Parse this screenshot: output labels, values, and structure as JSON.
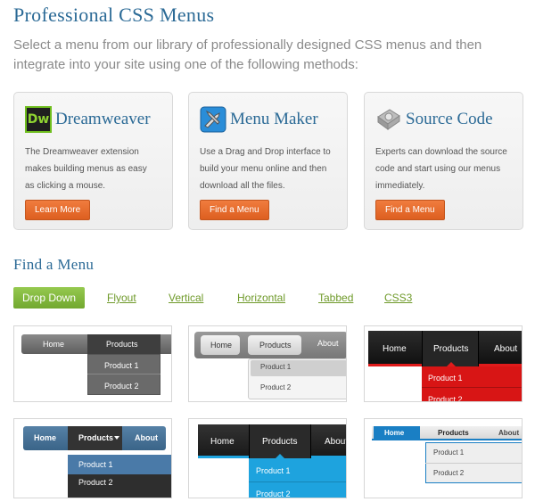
{
  "header": {
    "title": "Professional CSS Menus",
    "intro": "Select a menu from our library of professionally designed CSS menus and then integrate into your site using one of the following methods:"
  },
  "cards": [
    {
      "icon": "dreamweaver-icon",
      "icon_text": "Dw",
      "title": "Dreamweaver",
      "desc": "The Dreamweaver extension makes building menus as easy as clicking a mouse.",
      "button": "Learn More"
    },
    {
      "icon": "menu-maker-icon",
      "title": "Menu Maker",
      "desc": "Use a Drag and Drop interface to build your menu online and then download all the files.",
      "button": "Find a Menu"
    },
    {
      "icon": "source-code-icon",
      "title": "Source Code",
      "desc": "Experts can download the source code and start using our menus immediately.",
      "button": "Find a Menu"
    }
  ],
  "find": {
    "title": "Find a Menu",
    "tabs": [
      "Drop Down",
      "Flyout",
      "Vertical",
      "Horizontal",
      "Tabbed",
      "CSS3"
    ]
  },
  "thumbs": [
    {
      "items": [
        "Home",
        "Products"
      ],
      "sub": [
        "Product 1",
        "Product 2"
      ]
    },
    {
      "items": [
        "Home",
        "Products",
        "About"
      ],
      "sub": [
        "Product 1",
        "Product 2"
      ]
    },
    {
      "items": [
        "Home",
        "Products",
        "About"
      ],
      "sub": [
        "Product 1",
        "Product 2"
      ]
    },
    {
      "items": [
        "Home",
        "Products",
        "About"
      ],
      "sub": [
        "Product 1",
        "Product 2"
      ]
    },
    {
      "items": [
        "Home",
        "Products",
        "About"
      ],
      "sub": [
        "Product 1",
        "Product 2"
      ]
    },
    {
      "items": [
        "Home",
        "Products",
        "About"
      ],
      "sub": [
        "Product 1",
        "Product 2"
      ]
    }
  ],
  "colors": {
    "title_blue": "#2b6a96",
    "button_orange": "#e86a2b",
    "tab_green": "#7fb53a",
    "link_green": "#6f9a2a"
  }
}
